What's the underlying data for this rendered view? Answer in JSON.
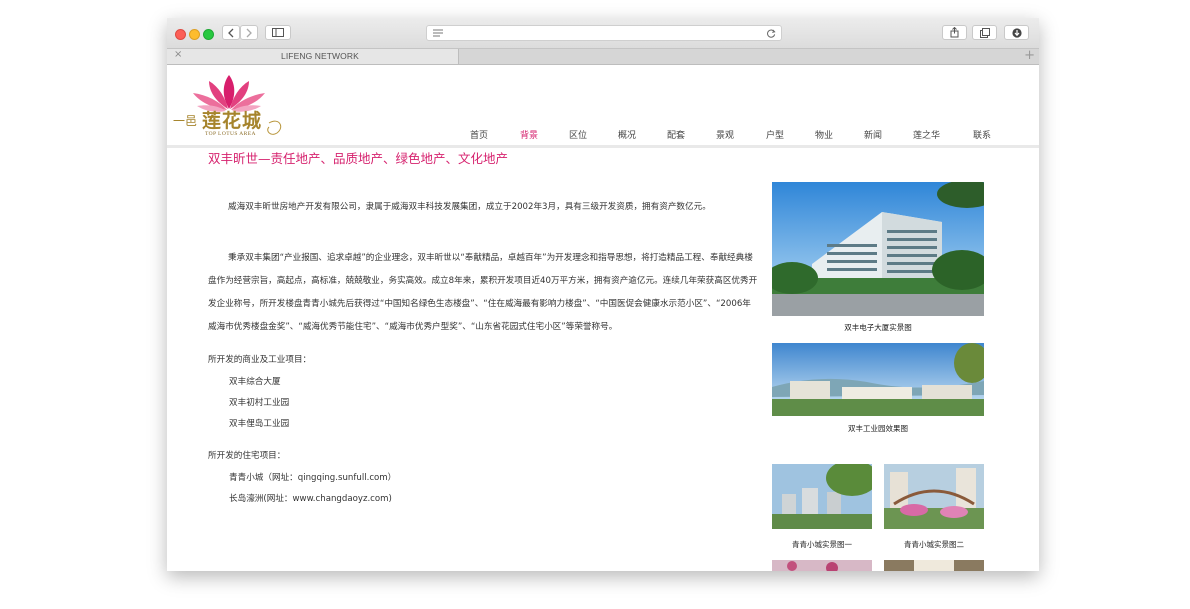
{
  "browser": {
    "tab_title": "LIFENG NETWORK",
    "tab_close": "×",
    "new_tab": "+"
  },
  "logo": {
    "prefix": "一邑",
    "main": "莲花城",
    "sub": "TOP LOTUS AREA"
  },
  "nav": {
    "items": [
      "首页",
      "背景",
      "区位",
      "概况",
      "配套",
      "景观",
      "户型",
      "物业",
      "新闻",
      "莲之华",
      "联系"
    ],
    "active": "背景"
  },
  "content": {
    "headline": "双丰昕世—责任地产、品质地产、绿色地产、文化地产",
    "paragraph1": "威海双丰昕世房地产开发有限公司，隶属于威海双丰科技发展集团，成立于2002年3月，具有三级开发资质，拥有资产数亿元。",
    "paragraph2": "秉承双丰集团“产业报国、追求卓越”的企业理念，双丰昕世以“奉献精品，卓越百年”为开发理念和指导思想，将打造精品工程、奉献经典楼盘作为经营宗旨，高起点，高标准，兢兢敬业，务实高效。成立8年来，累积开发项目近40万平方米，拥有资产逾亿元。连续几年荣获高区优秀开发企业称号，所开发楼盘青青小城先后获得过“中国知名绿色生态楼盘”、“住在威海最有影响力楼盘”、“中国医促会健康水示范小区”、“2006年威海市优秀楼盘金奖”、“威海优秀节能住宅”、“威海市优秀户型奖”、“山东省花园式住宅小区”等荣誉称号。",
    "commercial_label": "所开发的商业及工业项目：",
    "commercial_items": [
      "双丰综合大厦",
      "双丰初村工业园",
      "双丰俚岛工业园"
    ],
    "residential_label": "所开发的住宅项目：",
    "residential_items": [
      "青青小城（网址：qingqing.sunfull.com）",
      "长岛濠洲(网址：www.changdaoyz.com)"
    ]
  },
  "gallery": {
    "captions": [
      "双丰电子大厦实景图",
      "双丰工业园效果图",
      "青青小城实景图一",
      "青青小城实景图二"
    ]
  },
  "colors": {
    "accent": "#d6226e",
    "logo_gold": "#a6842c"
  }
}
